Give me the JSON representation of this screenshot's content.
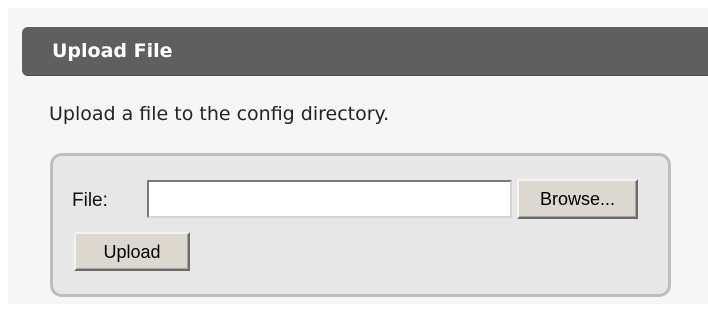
{
  "section": {
    "title": "Upload File",
    "description": "Upload a file to the config directory."
  },
  "form": {
    "file_label": "File:",
    "file_value": "",
    "browse_label": "Browse...",
    "upload_label": "Upload"
  },
  "colors": {
    "header_bg": "#5f5f5f",
    "header_text": "#ffffff",
    "panel_bg": "#f6f6f6",
    "box_bg": "#e7e7e7",
    "box_border": "#bdbdbd",
    "button_bg": "#ddd8cf"
  }
}
